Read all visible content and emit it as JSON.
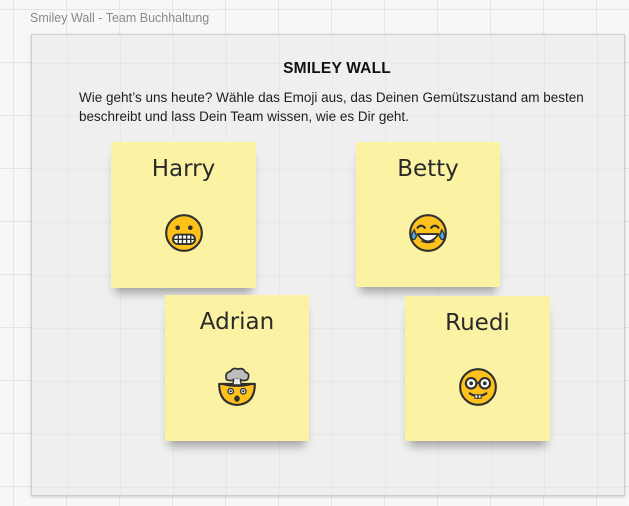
{
  "board": {
    "title": "Smiley Wall - Team Buchhaltung"
  },
  "frame": {
    "heading": "SMILEY WALL",
    "description": "Wie geht’s uns heute? Wähle das Emoji aus, das Deinen Gemütszustand am besten beschreibt und lass Dein Team wissen, wie es Dir geht."
  },
  "notes": [
    {
      "name": "Harry",
      "emoji": "grimacing-face-icon"
    },
    {
      "name": "Betty",
      "emoji": "face-with-tears-of-joy-icon"
    },
    {
      "name": "Adrian",
      "emoji": "exploding-head-icon"
    },
    {
      "name": "Ruedi",
      "emoji": "nerd-face-icon"
    }
  ],
  "colors": {
    "sticky_note": "#fbf3a3",
    "emoji_yellow": "#fcc21b",
    "emoji_outline": "#2f2f2f",
    "canvas": "#f7f7f7",
    "frame": "#efefef"
  }
}
